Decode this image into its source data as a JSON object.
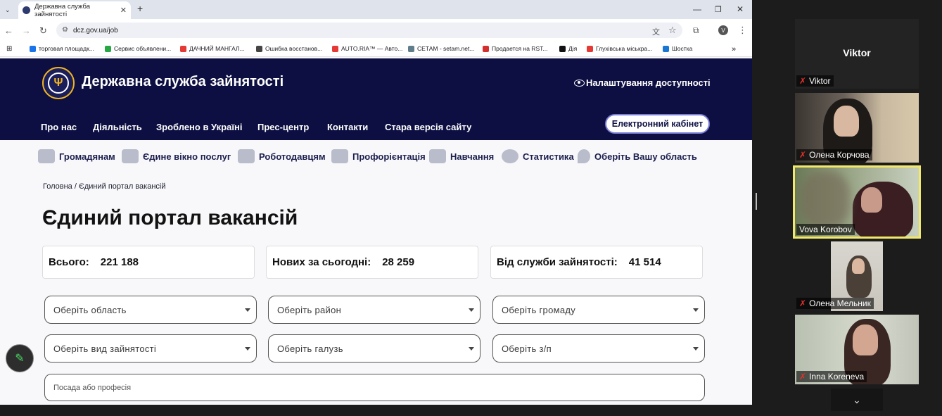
{
  "browser": {
    "tab_title": "Державна служба зайнятості",
    "url": "dcz.gov.ua/job",
    "new_tab": "+",
    "minimize": "—",
    "maximize": "❐",
    "close": "✕",
    "bookmarks": [
      "торговая площадк...",
      "Сервис объявлени...",
      "ДАЧНИЙ МАНГАЛ...",
      "Ошибка восстанов...",
      "AUTO.RIA™ — Авто...",
      "СЕТАМ - setam.net...",
      "Продается на RST...",
      "Дія",
      "Глухівська міськра...",
      "Шостка"
    ],
    "bookmark_colors": [
      "#1a73e8",
      "#28a745",
      "#e53935",
      "#444444",
      "#e53935",
      "#607d8b",
      "#d32f2f",
      "#111111",
      "#e53935",
      "#1976d2"
    ],
    "profile_initial": "V"
  },
  "site": {
    "title": "Державна служба зайнятості",
    "accessibility": "Налаштування доступності",
    "main_nav": [
      "Про нас",
      "Діяльність",
      "Зроблено в Україні",
      "Прес-центр",
      "Контакти",
      "Стара версія сайту"
    ],
    "cabinet": "Електронний кабінет",
    "categories": [
      "Громадянам",
      "Єдине вікно послуг",
      "Роботодавцям",
      "Профорієнтація",
      "Навчання",
      "Статистика",
      "Оберіть Вашу область"
    ],
    "breadcrumb": "Головна  /  Єдиний портал вакансій",
    "page_title": "Єдиний портал вакансій",
    "stats": [
      {
        "label": "Всього:",
        "value": "221 188"
      },
      {
        "label": "Нових за сьогодні:",
        "value": "28 259"
      },
      {
        "label": "Від служби зайнятості:",
        "value": "41 514"
      }
    ],
    "filters": [
      "Оберіть область",
      "Оберіть район",
      "Оберіть громаду",
      "Оберіть вид зайнятості",
      "Оберіть галузь",
      "Оберіть з/п"
    ],
    "position_placeholder": "Посада або професія"
  },
  "zoom": {
    "participants": [
      {
        "name": "Viktor",
        "video": false
      },
      {
        "name": "Олена Корчова",
        "video": true
      },
      {
        "name": "Vova Korobov",
        "video": true,
        "active": true
      },
      {
        "name": "Олена Мельник",
        "video": true
      },
      {
        "name": "Inna Koreneva",
        "video": true
      }
    ],
    "muted_color": "#e0322d",
    "active_color": "#f2e86a"
  }
}
